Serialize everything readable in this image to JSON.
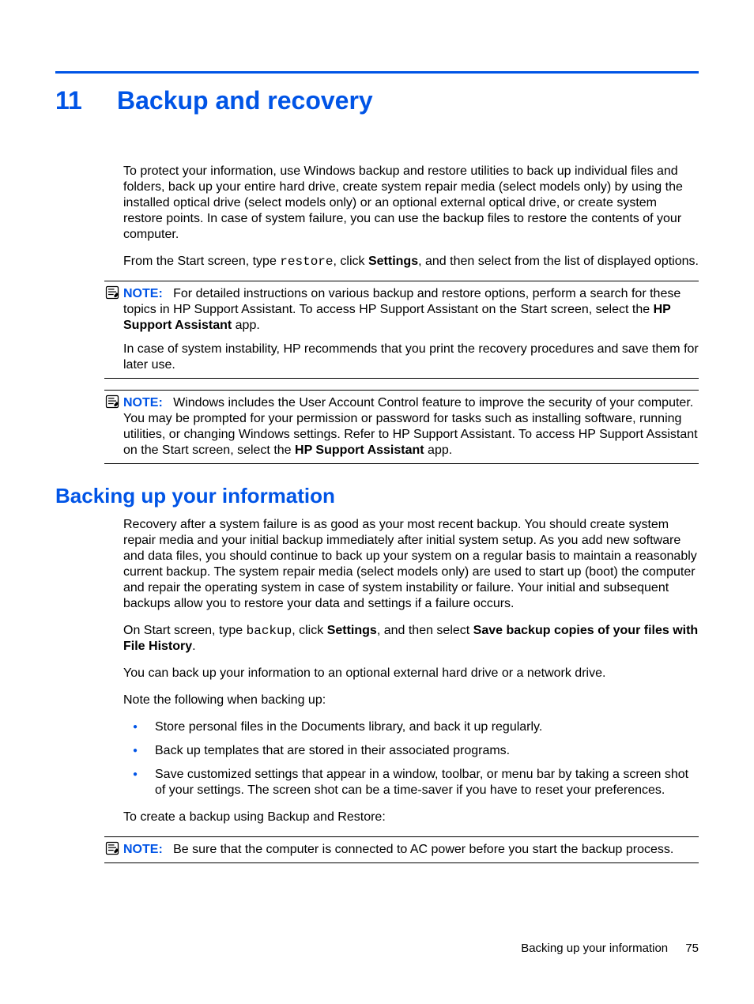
{
  "chapter": {
    "number": "11",
    "title": "Backup and recovery"
  },
  "intro": {
    "p1": "To protect your information, use Windows backup and restore utilities to back up individual files and folders, back up your entire hard drive, create system repair media (select models only) by using the installed optical drive (select models only) or an optional external optical drive, or create system restore points. In case of system failure, you can use the backup files to restore the contents of your computer.",
    "p2_a": "From the Start screen, type ",
    "p2_code": "restore",
    "p2_b": ", click ",
    "p2_bold": "Settings",
    "p2_c": ", and then select from the list of displayed options."
  },
  "note1": {
    "label": "NOTE:",
    "p1_a": "For detailed instructions on various backup and restore options, perform a search for these topics in HP Support Assistant. To access HP Support Assistant on the Start screen, select the ",
    "p1_bold": "HP Support Assistant",
    "p1_b": " app.",
    "p2": "In case of system instability, HP recommends that you print the recovery procedures and save them for later use."
  },
  "note2": {
    "label": "NOTE:",
    "p1_a": "Windows includes the User Account Control feature to improve the security of your computer. You may be prompted for your permission or password for tasks such as installing software, running utilities, or changing Windows settings. Refer to HP Support Assistant. To access HP Support Assistant on the Start screen, select the ",
    "p1_bold": "HP Support Assistant",
    "p1_b": " app."
  },
  "section": {
    "heading": "Backing up your information",
    "p1": "Recovery after a system failure is as good as your most recent backup. You should create system repair media and your initial backup immediately after initial system setup. As you add new software and data files, you should continue to back up your system on a regular basis to maintain a reasonably current backup. The system repair media (select models only) are used to start up (boot) the computer and repair the operating system in case of system instability or failure. Your initial and subsequent backups allow you to restore your data and settings if a failure occurs.",
    "p2_a": "On Start screen, type ",
    "p2_code": "backup",
    "p2_b": ", click ",
    "p2_bold1": "Settings",
    "p2_c": ", and then select ",
    "p2_bold2": "Save backup copies of your files with File History",
    "p2_d": ".",
    "p3": "You can back up your information to an optional external hard drive or a network drive.",
    "p4": "Note the following when backing up:",
    "bullets": [
      "Store personal files in the Documents library, and back it up regularly.",
      "Back up templates that are stored in their associated programs.",
      "Save customized settings that appear in a window, toolbar, or menu bar by taking a screen shot of your settings. The screen shot can be a time-saver if you have to reset your preferences."
    ],
    "p5": "To create a backup using Backup and Restore:"
  },
  "note3": {
    "label": "NOTE:",
    "p1": "Be sure that the computer is connected to AC power before you start the backup process."
  },
  "footer": {
    "text": "Backing up your information",
    "page": "75"
  }
}
